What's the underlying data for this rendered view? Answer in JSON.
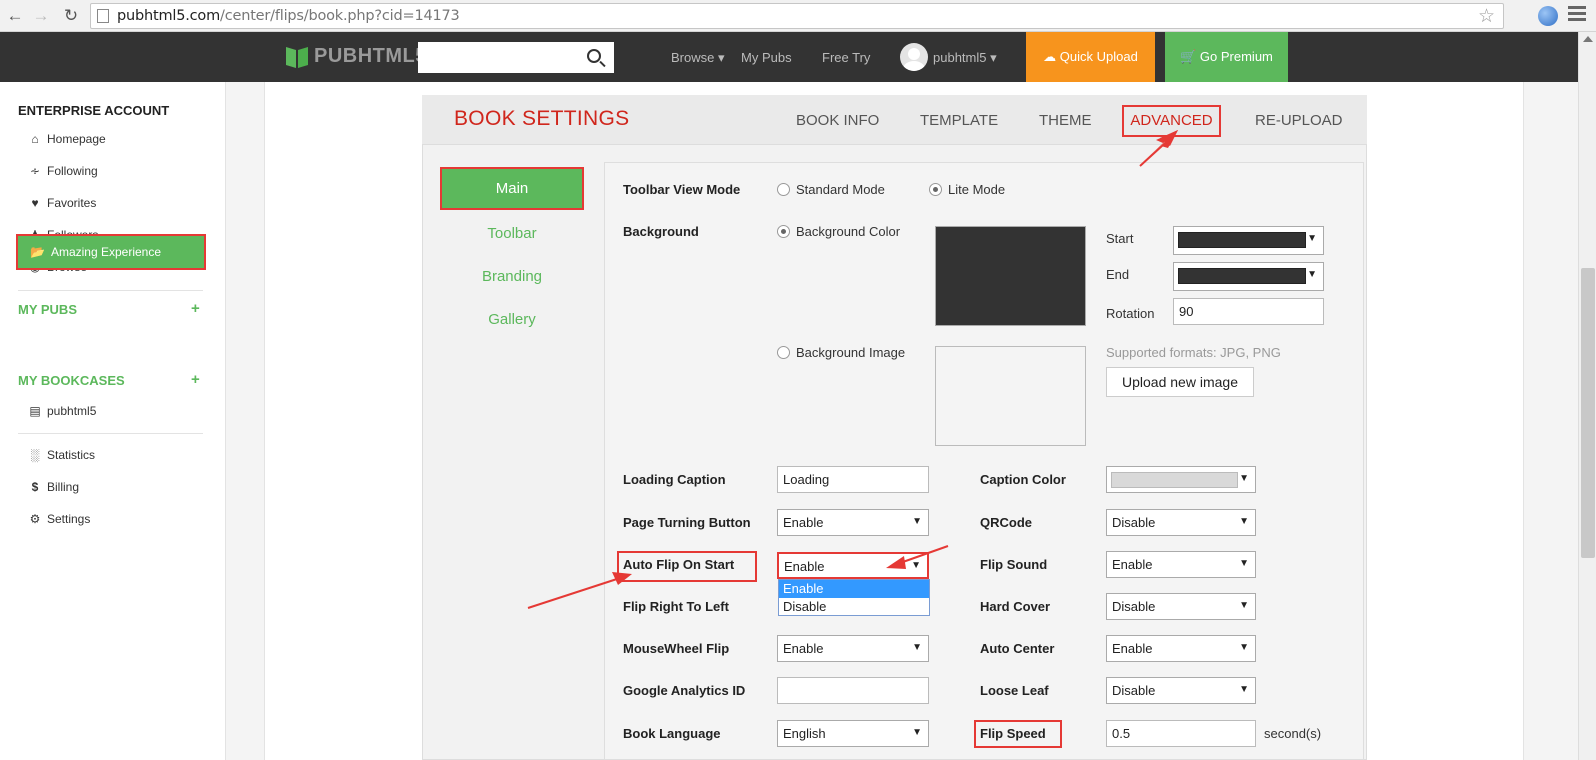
{
  "browser": {
    "url_host": "pubhtml5.com",
    "url_path": "/center/flips/book.php?cid=14173"
  },
  "topnav": {
    "logo": "PUBHTML5",
    "browse": "Browse ▾",
    "my_pubs": "My Pubs",
    "free_try": "Free Try",
    "user": "pubhtml5 ▾",
    "quick_upload": "Quick Upload",
    "go_premium": "Go Premium"
  },
  "sidebar": {
    "account_header": "ENTERPRISE ACCOUNT",
    "items": [
      {
        "label": "Homepage",
        "icon": "home-icon"
      },
      {
        "label": "Following",
        "icon": "rss-icon"
      },
      {
        "label": "Favorites",
        "icon": "heart-icon"
      },
      {
        "label": "Followers",
        "icon": "users-icon"
      },
      {
        "label": "Browse",
        "icon": "eye-icon"
      }
    ],
    "my_pubs": "MY PUBS",
    "pub_item": "Amazing Experience",
    "my_bookcases": "MY BOOKCASES",
    "bookcase_item": "pubhtml5",
    "bottom_items": [
      {
        "label": "Statistics",
        "icon": "bar-chart-icon"
      },
      {
        "label": "Billing",
        "icon": "dollar-icon"
      },
      {
        "label": "Settings",
        "icon": "gear-icon"
      }
    ],
    "plus": "+"
  },
  "panel": {
    "title": "BOOK SETTINGS",
    "tabs": [
      "BOOK INFO",
      "TEMPLATE",
      "THEME",
      "ADVANCED",
      "RE-UPLOAD"
    ],
    "active_tab": "ADVANCED",
    "left_tabs": [
      "Main",
      "Toolbar",
      "Branding",
      "Gallery"
    ]
  },
  "settings": {
    "toolbar_view_mode": {
      "label": "Toolbar View Mode",
      "opt1": "Standard Mode",
      "opt2": "Lite Mode",
      "selected": "Lite Mode"
    },
    "background": {
      "label": "Background",
      "color_option": "Background Color",
      "image_option": "Background Image",
      "start_label": "Start",
      "end_label": "End",
      "rotation_label": "Rotation",
      "rotation_value": "90",
      "supported": "Supported formats: JPG, PNG",
      "upload_button": "Upload new image",
      "start_color": "#333333",
      "end_color": "#333333"
    },
    "loading_caption": {
      "label": "Loading Caption",
      "value": "Loading"
    },
    "caption_color": {
      "label": "Caption Color",
      "value": "#d9d9d9"
    },
    "page_turning_button": {
      "label": "Page Turning Button",
      "value": "Enable"
    },
    "qrcode": {
      "label": "QRCode",
      "value": "Disable"
    },
    "auto_flip_on_start": {
      "label": "Auto Flip On Start",
      "value": "Enable",
      "options": [
        "Enable",
        "Disable"
      ]
    },
    "flip_sound": {
      "label": "Flip Sound",
      "value": "Enable"
    },
    "flip_right_to_left": {
      "label": "Flip Right To Left"
    },
    "hard_cover": {
      "label": "Hard Cover",
      "value": "Disable"
    },
    "mousewheel_flip": {
      "label": "MouseWheel Flip",
      "value": "Enable"
    },
    "auto_center": {
      "label": "Auto Center",
      "value": "Enable"
    },
    "google_analytics_id": {
      "label": "Google Analytics ID",
      "value": ""
    },
    "loose_leaf": {
      "label": "Loose Leaf",
      "value": "Disable"
    },
    "book_language": {
      "label": "Book Language",
      "value": "English"
    },
    "flip_speed": {
      "label": "Flip Speed",
      "value": "0.5",
      "unit": "second(s)"
    }
  }
}
